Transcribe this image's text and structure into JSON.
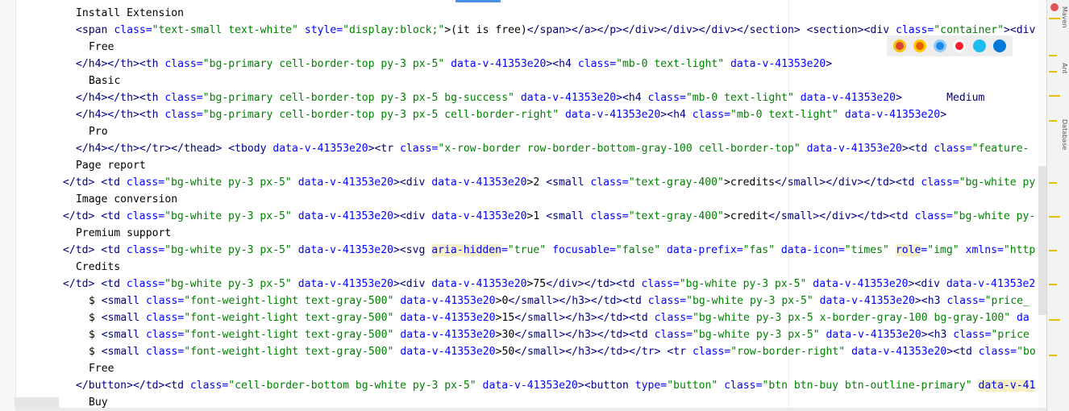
{
  "editor": {
    "lines": [
      {
        "fold": false,
        "indent": 94,
        "tokens": [
          {
            "t": "Install Extension",
            "c": "txt"
          }
        ]
      },
      {
        "fold": true,
        "indent": 94,
        "tokens": [
          {
            "t": "<span ",
            "c": "tag"
          },
          {
            "t": "class=",
            "c": "attr"
          },
          {
            "t": "\"text-small text-white\"",
            "c": "val"
          },
          {
            "t": " style=",
            "c": "attr"
          },
          {
            "t": "\"display:block;\"",
            "c": "val"
          },
          {
            "t": ">(it is free)",
            "c": "txt"
          },
          {
            "t": "</span></a></p></div></div></div></section> <section><div ",
            "c": "tag"
          },
          {
            "t": "class=",
            "c": "attr"
          },
          {
            "t": "\"container\"",
            "c": "val"
          },
          {
            "t": "><div",
            "c": "tag"
          }
        ]
      },
      {
        "fold": false,
        "indent": 110,
        "tokens": [
          {
            "t": "Free",
            "c": "txt"
          }
        ]
      },
      {
        "fold": true,
        "indent": 94,
        "tokens": [
          {
            "t": "</h4></th><th ",
            "c": "tag"
          },
          {
            "t": "class=",
            "c": "attr"
          },
          {
            "t": "\"bg-primary cell-border-top py-3 px-5\"",
            "c": "val"
          },
          {
            "t": " data-v-41353e20",
            "c": "attr"
          },
          {
            "t": "><h4 ",
            "c": "tag"
          },
          {
            "t": "class=",
            "c": "attr"
          },
          {
            "t": "\"mb-0 text-light\"",
            "c": "val"
          },
          {
            "t": " data-v-41353e20",
            "c": "attr"
          },
          {
            "t": ">",
            "c": "tag"
          }
        ]
      },
      {
        "fold": false,
        "indent": 110,
        "tokens": [
          {
            "t": "Basic",
            "c": "txt"
          }
        ]
      },
      {
        "fold": true,
        "indent": 94,
        "tokens": [
          {
            "t": "</h4></th><th ",
            "c": "tag"
          },
          {
            "t": "class=",
            "c": "attr"
          },
          {
            "t": "\"bg-primary cell-border-top py-3 px-5 bg-success\"",
            "c": "val"
          },
          {
            "t": " data-v-41353e20",
            "c": "attr"
          },
          {
            "t": "><h4 ",
            "c": "tag"
          },
          {
            "t": "class=",
            "c": "attr"
          },
          {
            "t": "\"mb-0 text-light\"",
            "c": "val"
          },
          {
            "t": " data-v-41353e20",
            "c": "attr"
          },
          {
            "t": ">       Medium",
            "c": "tag"
          }
        ]
      },
      {
        "fold": true,
        "indent": 94,
        "tokens": [
          {
            "t": "</h4></th><th ",
            "c": "tag"
          },
          {
            "t": "class=",
            "c": "attr"
          },
          {
            "t": "\"bg-primary cell-border-top py-3 px-5 cell-border-right\"",
            "c": "val"
          },
          {
            "t": " data-v-41353e20",
            "c": "attr"
          },
          {
            "t": "><h4 ",
            "c": "tag"
          },
          {
            "t": "class=",
            "c": "attr"
          },
          {
            "t": "\"mb-0 text-light\"",
            "c": "val"
          },
          {
            "t": " data-v-41353e20",
            "c": "attr"
          },
          {
            "t": ">",
            "c": "tag"
          }
        ]
      },
      {
        "fold": false,
        "indent": 110,
        "tokens": [
          {
            "t": "Pro",
            "c": "txt"
          }
        ]
      },
      {
        "fold": true,
        "indent": 94,
        "tokens": [
          {
            "t": "</h4></th></tr></thead> <tbody ",
            "c": "tag"
          },
          {
            "t": "data-v-41353e20",
            "c": "attr"
          },
          {
            "t": "><tr ",
            "c": "tag"
          },
          {
            "t": "class=",
            "c": "attr"
          },
          {
            "t": "\"x-row-border row-border-bottom-gray-100 cell-border-top\"",
            "c": "val"
          },
          {
            "t": " data-v-41353e20",
            "c": "attr"
          },
          {
            "t": "><td ",
            "c": "tag"
          },
          {
            "t": "class=",
            "c": "attr"
          },
          {
            "t": "\"feature-",
            "c": "val"
          }
        ]
      },
      {
        "fold": false,
        "indent": 94,
        "tokens": [
          {
            "t": "Page report",
            "c": "txt"
          }
        ]
      },
      {
        "fold": true,
        "indent": 78,
        "tokens": [
          {
            "t": "</td> <td ",
            "c": "tag"
          },
          {
            "t": "class=",
            "c": "attr"
          },
          {
            "t": "\"bg-white py-3 px-5\"",
            "c": "val"
          },
          {
            "t": " data-v-41353e20",
            "c": "attr"
          },
          {
            "t": "><div ",
            "c": "tag"
          },
          {
            "t": "data-v-41353e20",
            "c": "attr"
          },
          {
            "t": ">2 ",
            "c": "txt"
          },
          {
            "t": "<small ",
            "c": "tag"
          },
          {
            "t": "class=",
            "c": "attr"
          },
          {
            "t": "\"text-gray-400\"",
            "c": "val"
          },
          {
            "t": ">credits",
            "c": "txt"
          },
          {
            "t": "</small></div></td><td ",
            "c": "tag"
          },
          {
            "t": "class=",
            "c": "attr"
          },
          {
            "t": "\"bg-white py",
            "c": "val"
          }
        ]
      },
      {
        "fold": false,
        "indent": 94,
        "tokens": [
          {
            "t": "Image conversion",
            "c": "txt"
          }
        ]
      },
      {
        "fold": true,
        "indent": 78,
        "tokens": [
          {
            "t": "</td> <td ",
            "c": "tag"
          },
          {
            "t": "class=",
            "c": "attr"
          },
          {
            "t": "\"bg-white py-3 px-5\"",
            "c": "val"
          },
          {
            "t": " data-v-41353e20",
            "c": "attr"
          },
          {
            "t": "><div ",
            "c": "tag"
          },
          {
            "t": "data-v-41353e20",
            "c": "attr"
          },
          {
            "t": ">1 ",
            "c": "txt"
          },
          {
            "t": "<small ",
            "c": "tag"
          },
          {
            "t": "class=",
            "c": "attr"
          },
          {
            "t": "\"text-gray-400\"",
            "c": "val"
          },
          {
            "t": ">credit",
            "c": "txt"
          },
          {
            "t": "</small></div></td><td ",
            "c": "tag"
          },
          {
            "t": "class=",
            "c": "attr"
          },
          {
            "t": "\"bg-white py-",
            "c": "val"
          }
        ]
      },
      {
        "fold": false,
        "indent": 94,
        "tokens": [
          {
            "t": "Premium support",
            "c": "txt"
          }
        ]
      },
      {
        "fold": true,
        "indent": 78,
        "tokens": [
          {
            "t": "</td> <td ",
            "c": "tag"
          },
          {
            "t": "class=",
            "c": "attr"
          },
          {
            "t": "\"bg-white py-3 px-5\"",
            "c": "val"
          },
          {
            "t": " data-v-41353e20",
            "c": "attr"
          },
          {
            "t": "><svg ",
            "c": "tag"
          },
          {
            "t": "aria-hidden",
            "c": "attr",
            "hl": true
          },
          {
            "t": "=",
            "c": "attr"
          },
          {
            "t": "\"true\"",
            "c": "val"
          },
          {
            "t": " focusable=",
            "c": "attr"
          },
          {
            "t": "\"false\"",
            "c": "val"
          },
          {
            "t": " data-prefix=",
            "c": "attr"
          },
          {
            "t": "\"fas\"",
            "c": "val"
          },
          {
            "t": " data-icon=",
            "c": "attr"
          },
          {
            "t": "\"times\" ",
            "c": "val"
          },
          {
            "t": "role",
            "c": "attr",
            "hl": true
          },
          {
            "t": "=",
            "c": "attr"
          },
          {
            "t": "\"img\"",
            "c": "val"
          },
          {
            "t": " xmlns=",
            "c": "attr"
          },
          {
            "t": "\"http",
            "c": "val"
          }
        ]
      },
      {
        "fold": false,
        "indent": 94,
        "tokens": [
          {
            "t": "Credits",
            "c": "txt"
          }
        ]
      },
      {
        "fold": true,
        "indent": 78,
        "tokens": [
          {
            "t": "</td> <td ",
            "c": "tag"
          },
          {
            "t": "class=",
            "c": "attr"
          },
          {
            "t": "\"bg-white py-3 px-5\"",
            "c": "val"
          },
          {
            "t": " data-v-41353e20",
            "c": "attr"
          },
          {
            "t": "><div ",
            "c": "tag"
          },
          {
            "t": "data-v-41353e20",
            "c": "attr"
          },
          {
            "t": ">75",
            "c": "txt"
          },
          {
            "t": "</div></td><td ",
            "c": "tag"
          },
          {
            "t": "class=",
            "c": "attr"
          },
          {
            "t": "\"bg-white py-3 px-5\"",
            "c": "val"
          },
          {
            "t": " data-v-41353e20",
            "c": "attr"
          },
          {
            "t": "><div ",
            "c": "tag"
          },
          {
            "t": "data-v-41353e2",
            "c": "attr"
          }
        ]
      },
      {
        "fold": true,
        "indent": 110,
        "tokens": [
          {
            "t": "$ ",
            "c": "txt"
          },
          {
            "t": "<small ",
            "c": "tag"
          },
          {
            "t": "class=",
            "c": "attr"
          },
          {
            "t": "\"font-weight-light text-gray-500\"",
            "c": "val"
          },
          {
            "t": " data-v-41353e20",
            "c": "attr"
          },
          {
            "t": ">0",
            "c": "txt"
          },
          {
            "t": "</small></h3></td><td ",
            "c": "tag"
          },
          {
            "t": "class=",
            "c": "attr"
          },
          {
            "t": "\"bg-white py-3 px-5\"",
            "c": "val"
          },
          {
            "t": " data-v-41353e20",
            "c": "attr"
          },
          {
            "t": "><h3 ",
            "c": "tag"
          },
          {
            "t": "class=",
            "c": "attr"
          },
          {
            "t": "\"price_",
            "c": "val"
          }
        ]
      },
      {
        "fold": true,
        "indent": 110,
        "tokens": [
          {
            "t": "$ ",
            "c": "txt"
          },
          {
            "t": "<small ",
            "c": "tag"
          },
          {
            "t": "class=",
            "c": "attr"
          },
          {
            "t": "\"font-weight-light text-gray-500\"",
            "c": "val"
          },
          {
            "t": " data-v-41353e20",
            "c": "attr"
          },
          {
            "t": ">15",
            "c": "txt"
          },
          {
            "t": "</small></h3></td><td ",
            "c": "tag"
          },
          {
            "t": "class=",
            "c": "attr"
          },
          {
            "t": "\"bg-white py-3 px-5 x-border-gray-100 bg-gray-100\"",
            "c": "val"
          },
          {
            "t": " da",
            "c": "attr"
          }
        ]
      },
      {
        "fold": true,
        "indent": 110,
        "tokens": [
          {
            "t": "$ ",
            "c": "txt"
          },
          {
            "t": "<small ",
            "c": "tag"
          },
          {
            "t": "class=",
            "c": "attr"
          },
          {
            "t": "\"font-weight-light text-gray-500\"",
            "c": "val"
          },
          {
            "t": " data-v-41353e20",
            "c": "attr"
          },
          {
            "t": ">30",
            "c": "txt"
          },
          {
            "t": "</small></h3></td><td ",
            "c": "tag"
          },
          {
            "t": "class=",
            "c": "attr"
          },
          {
            "t": "\"bg-white py-3 px-5\"",
            "c": "val"
          },
          {
            "t": " data-v-41353e20",
            "c": "attr"
          },
          {
            "t": "><h3 ",
            "c": "tag"
          },
          {
            "t": "class=",
            "c": "attr"
          },
          {
            "t": "\"price",
            "c": "val"
          }
        ]
      },
      {
        "fold": true,
        "indent": 110,
        "tokens": [
          {
            "t": "$ ",
            "c": "txt"
          },
          {
            "t": "<small ",
            "c": "tag"
          },
          {
            "t": "class=",
            "c": "attr"
          },
          {
            "t": "\"font-weight-light text-gray-500\"",
            "c": "val"
          },
          {
            "t": " data-v-41353e20",
            "c": "attr"
          },
          {
            "t": ">50",
            "c": "txt"
          },
          {
            "t": "</small></h3></td></tr> <tr ",
            "c": "tag"
          },
          {
            "t": "class=",
            "c": "attr"
          },
          {
            "t": "\"row-border-right\"",
            "c": "val"
          },
          {
            "t": " data-v-41353e20",
            "c": "attr"
          },
          {
            "t": "><td ",
            "c": "tag"
          },
          {
            "t": "class=",
            "c": "attr"
          },
          {
            "t": "\"bo",
            "c": "val"
          }
        ]
      },
      {
        "fold": false,
        "indent": 110,
        "tokens": [
          {
            "t": "Free",
            "c": "txt"
          }
        ]
      },
      {
        "fold": true,
        "indent": 94,
        "tokens": [
          {
            "t": "</button></td><td ",
            "c": "tag"
          },
          {
            "t": "class=",
            "c": "attr"
          },
          {
            "t": "\"cell-border-bottom bg-white py-3 px-5\"",
            "c": "val"
          },
          {
            "t": " data-v-41353e20",
            "c": "attr"
          },
          {
            "t": "><button ",
            "c": "tag"
          },
          {
            "t": "type=",
            "c": "attr"
          },
          {
            "t": "\"button\"",
            "c": "val"
          },
          {
            "t": " class=",
            "c": "attr"
          },
          {
            "t": "\"btn btn-buy btn-outline-primary\" ",
            "c": "val"
          },
          {
            "t": "data-v-41",
            "c": "attr",
            "hl": true
          }
        ]
      },
      {
        "fold": false,
        "indent": 110,
        "tokens": [
          {
            "t": "Buy",
            "c": "txt"
          }
        ]
      }
    ]
  },
  "browsers": [
    {
      "icon": "chrome-icon",
      "color": "#db4437",
      "ring": "#f4c20d"
    },
    {
      "icon": "firefox-icon",
      "color": "#e66000",
      "ring": "#ffcb00"
    },
    {
      "icon": "safari-icon",
      "color": "#1e88e5",
      "ring": "#90caf9"
    },
    {
      "icon": "opera-icon",
      "color": "#ff1b2d",
      "ring": "#ffffff"
    },
    {
      "icon": "internet-explorer-icon",
      "color": "#1ebbee",
      "ring": "#1ebbee"
    },
    {
      "icon": "edge-icon",
      "color": "#0078d7",
      "ring": "#0078d7"
    }
  ],
  "scroll_marks": [
    22,
    68,
    88,
    118,
    149,
    226,
    268,
    310,
    352,
    396,
    440
  ],
  "side_labels": [
    "Maven",
    "Ant",
    "Database"
  ]
}
